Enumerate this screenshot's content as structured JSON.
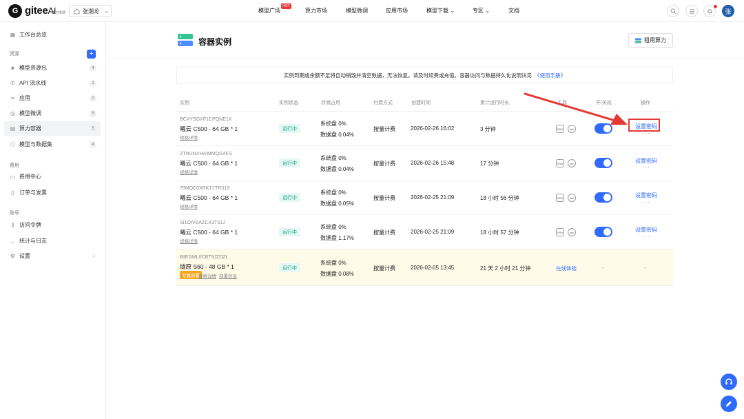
{
  "topbar": {
    "logo_mark": "G",
    "logo_text": "gitee",
    "logo_ai": "AI",
    "logo_sub": "算力市场",
    "workspace": "张潮龙",
    "nav": [
      "模型广场",
      "算力市场",
      "模型微调",
      "应用市场",
      "模型下载",
      "专区",
      "文档"
    ],
    "hot": "HOT",
    "avatar": "张"
  },
  "sidebar": {
    "overview": "工作台总览",
    "section_resources": "资源",
    "resources": [
      {
        "label": "模型资源包",
        "count": "4"
      },
      {
        "label": "API 流水线",
        "count": "2"
      },
      {
        "label": "应用",
        "count": "0"
      },
      {
        "label": "模型微调",
        "count": "5"
      },
      {
        "label": "算力容器",
        "count": "5"
      },
      {
        "label": "模型与数据集",
        "count": "4"
      }
    ],
    "section_billing": "费用",
    "billing": [
      "费用中心",
      "订单与发票"
    ],
    "section_account": "账号",
    "account": [
      "访问令牌",
      "统计与日志",
      "设置"
    ]
  },
  "main": {
    "title": "容器实例",
    "rent_button": "租用算力",
    "notice": "实例到期或余额不足将自动销毁并清空数据，无法恢复。请及时续费或充值。容器访问与数据持久化说明详见",
    "notice_link": "《使用手册》",
    "columns": [
      "实例",
      "实例状态",
      "存储占用",
      "付费方式",
      "创建时间",
      "累计运行时长",
      "工具",
      "开/关机",
      "操作"
    ],
    "rows": [
      {
        "id": "BCXYSGXF1CPQNE1X",
        "spec": "曦云 C500 - 64 GB * 1",
        "link": "规格详情",
        "status": "运行中",
        "sys": "系统盘 0%",
        "data": "数据盘 0.04%",
        "pay": "按量计费",
        "created": "2026-02-26 16:02",
        "runtime": "3 分钟",
        "op": "设置密码",
        "more": "···"
      },
      {
        "id": "ZTWJNXHAIMMQG4FG",
        "spec": "曦云 C500 - 64 GB * 1",
        "link": "规格详情",
        "status": "运行中",
        "sys": "系统盘 0%",
        "data": "数据盘 0.04%",
        "pay": "按量计费",
        "created": "2026-02-26 15:48",
        "runtime": "17 分钟",
        "op": "设置密码",
        "more": "···"
      },
      {
        "id": "70MQC0XRK1YTR313",
        "spec": "曦云 C500 - 64 GB * 1",
        "link": "规格详情",
        "status": "运行中",
        "sys": "系统盘 0%",
        "data": "数据盘 0.05%",
        "pay": "按量计费",
        "created": "2026-02-25 21:09",
        "runtime": "18 小时 56 分钟",
        "op": "设置密码",
        "more": "···"
      },
      {
        "id": "SI1OIVEAZCX3TS1J",
        "spec": "曦云 C500 - 64 GB * 1",
        "link": "规格详情",
        "status": "运行中",
        "sys": "系统盘 0%",
        "data": "数据盘 1.17%",
        "pay": "按量计费",
        "created": "2026-02-25 21:09",
        "runtime": "18 小时 57 分钟",
        "op": "设置密码",
        "more": "···"
      }
    ],
    "special_row": {
      "id": "68EGML0CBT9JZDZL",
      "spec": "燧原 S60 - 48 GB * 1",
      "badge": "专属部署",
      "link1": "规格详情",
      "link2": "部署信息",
      "status": "运行中",
      "sys": "系统盘 0%",
      "data": "数据盘 0.08%",
      "pay": "按量计费",
      "created": "2026-02-05 13:45",
      "runtime": "21 天 2 小时 21 分钟",
      "tool": "在线体验",
      "power": "-",
      "op": "-"
    },
    "tools": {
      "ssh": "SSH",
      "lab": "lab"
    }
  },
  "colors": {
    "accent": "#2f6bff",
    "running": "#1ba784",
    "highlight": "#e53935",
    "special_bg": "#fffbe8"
  }
}
